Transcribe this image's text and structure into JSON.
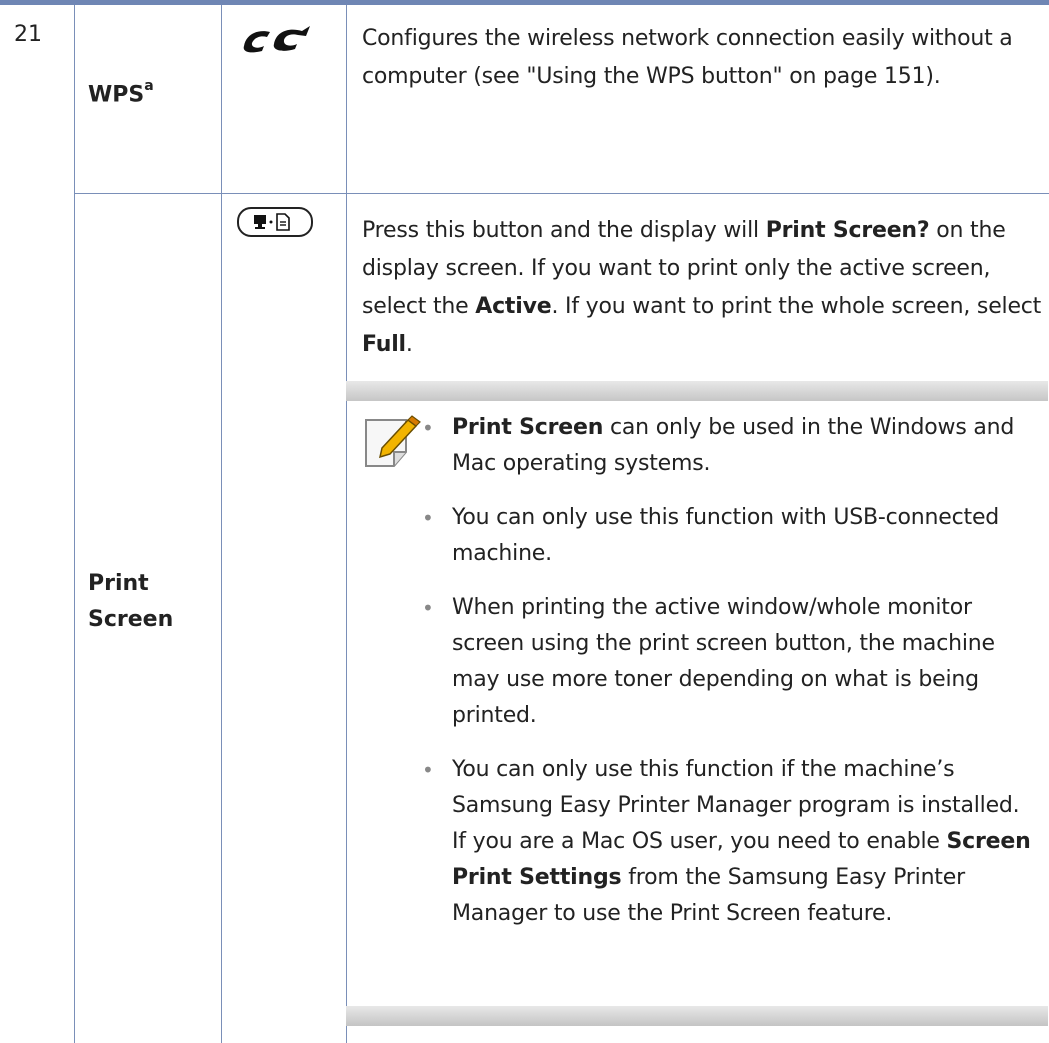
{
  "row_number": "21",
  "rows": [
    {
      "name": "WPS",
      "footnote": "a",
      "icon": "wps-icon",
      "description": "Configures the wireless network connection easily without a computer (see \"Using the WPS button\" on page 151)."
    },
    {
      "name_line1": "Print",
      "name_line2": "Screen",
      "icon": "print-screen-icon",
      "desc_part1": "Press this button and the display will ",
      "desc_bold1": "Print Screen?",
      "desc_part2": " on the display screen. If you want to print only the active screen, select the ",
      "desc_bold2": "Active",
      "desc_part3": ". If you want to print the whole screen, select ",
      "desc_bold3": "Full",
      "desc_part4": "."
    }
  ],
  "note": {
    "icon": "note-pencil-icon",
    "bullets": {
      "b1_bold": "Print Screen",
      "b1_text": " can only be used in the Windows and Mac operating systems.",
      "b2_text": "You can only use this function with USB-connected machine.",
      "b3_text": "When printing the active window/whole monitor screen using the print screen button, the machine may use more toner depending on what is being printed.",
      "b4_text1": "You can only use this function if the machine’s Samsung Easy Printer Manager program is installed. If you are a Mac OS user, you need to enable ",
      "b4_bold": "Screen Print Settings",
      "b4_text2": " from the Samsung Easy Printer Manager to use the Print Screen feature."
    }
  }
}
